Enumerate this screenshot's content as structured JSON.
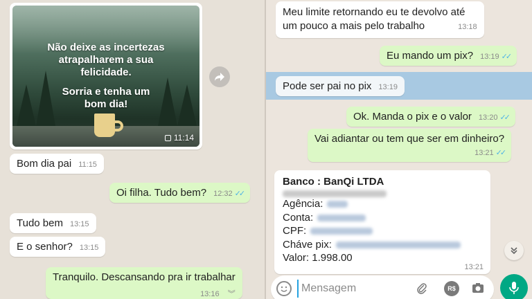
{
  "image_message": {
    "text_line1": "Não deixe as incertezas",
    "text_line2": "atrapalharem a sua",
    "text_line3": "felicidade.",
    "text_line4": "Sorria e tenha um",
    "text_line5": "bom dia!",
    "time": "11:14"
  },
  "left_messages": [
    {
      "text": "Bom dia pai",
      "time": "11:15"
    },
    {
      "text": "Oi filha.  Tudo bem?",
      "time": "12:32"
    },
    {
      "text": "Tudo bem",
      "time": "13:15"
    },
    {
      "text": "E o senhor?",
      "time": "13:15"
    },
    {
      "text": "Tranquilo.  Descansando pra ir trabalhar",
      "time": "13:16"
    }
  ],
  "right_messages": [
    {
      "text_line1": "Meu limite retornando eu te devolvo até",
      "text_line2": "um pouco a mais pelo trabalho",
      "time": "13:18"
    },
    {
      "text": "Eu mando um pix?",
      "time": "13:19"
    },
    {
      "text": "Pode ser pai no pix",
      "time": "13:19"
    },
    {
      "text": "Ok. Manda o pix e o valor",
      "time": "13:20"
    },
    {
      "text": "Vai adiantar ou tem que ser em dinheiro?",
      "time": "13:21"
    }
  ],
  "bank_card": {
    "title": "Banco : BanQi LTDA",
    "agencia_label": "Agência:",
    "conta_label": "Conta:",
    "cpf_label": "CPF:",
    "chave_label": "Cháve pix:",
    "valor": "Valor: 1.998.00",
    "time": "13:21"
  },
  "composer": {
    "placeholder": "Mensagem",
    "rs_label": "R$"
  },
  "colors": {
    "outgoing": "#dcf8c6",
    "incoming": "#ffffff",
    "ticks": "#4fb3e6",
    "mic": "#00a884",
    "highlight": "#a8c9e2"
  }
}
